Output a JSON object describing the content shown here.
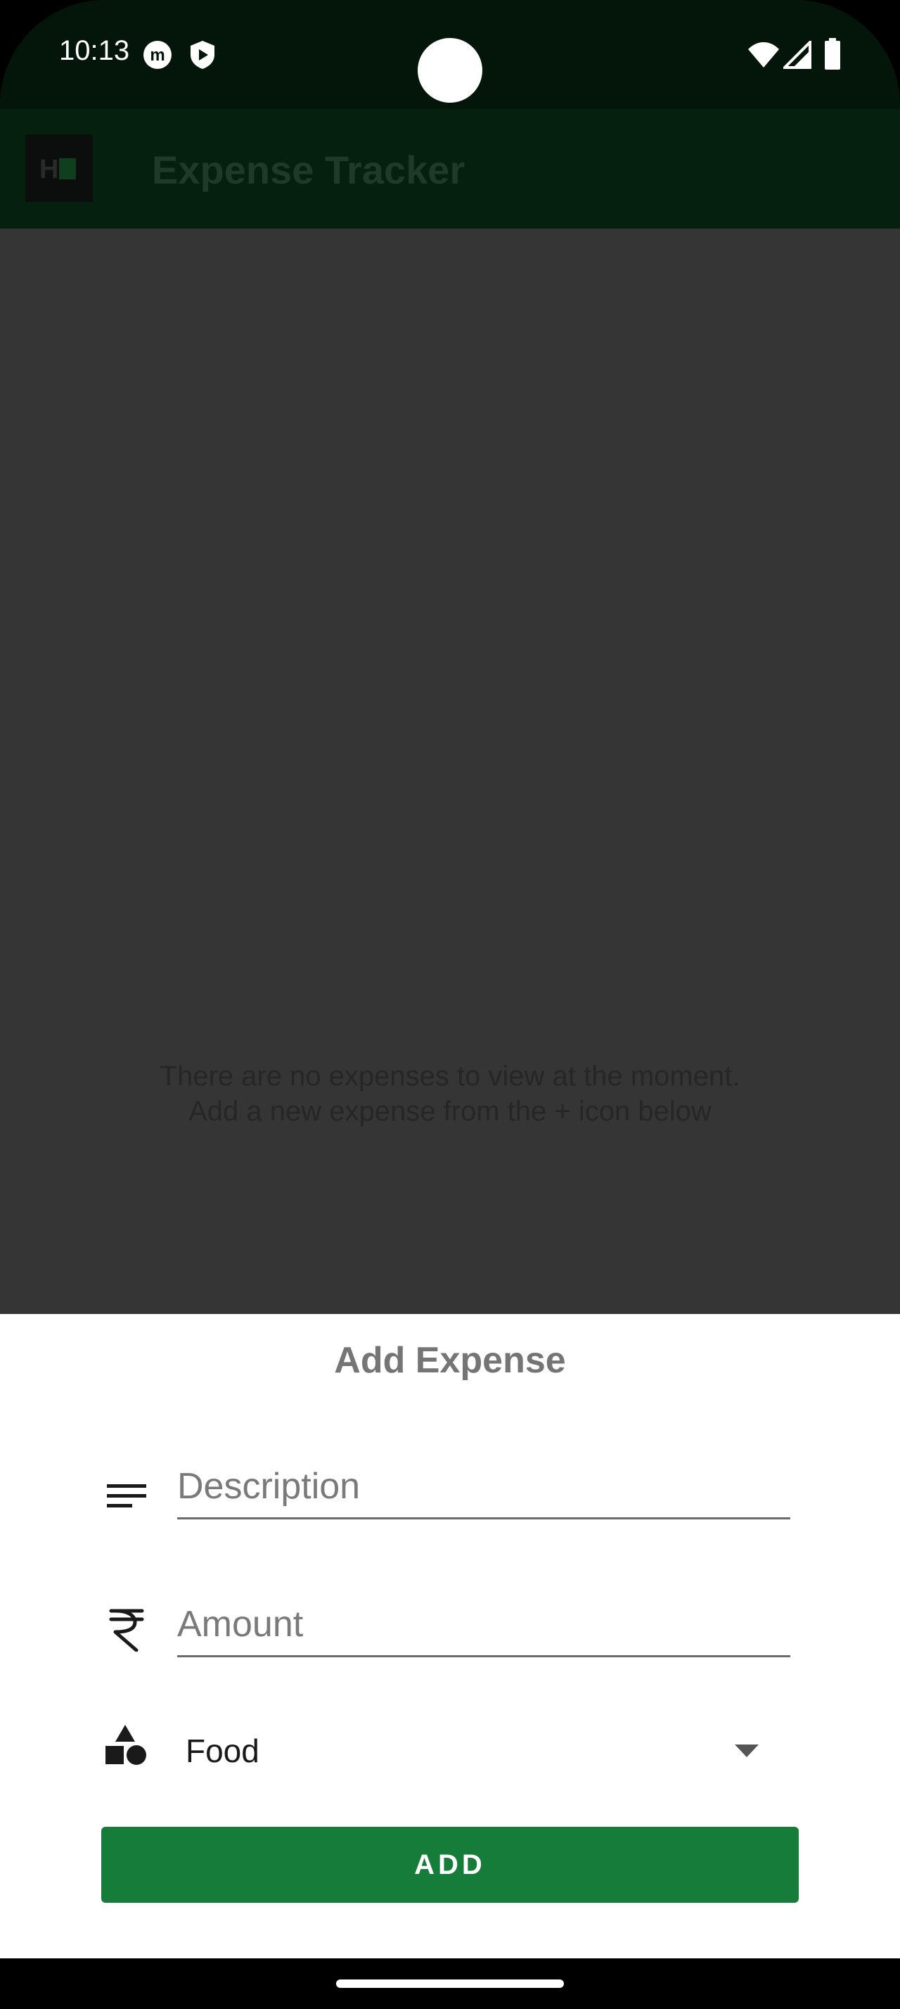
{
  "status_bar": {
    "time": "10:13",
    "icons": [
      "m-notification-icon",
      "shield-play-icon",
      "wifi-icon",
      "signal-icon",
      "battery-icon"
    ]
  },
  "app_bar": {
    "title": "Expense Tracker",
    "logo_text": "H"
  },
  "empty_state": {
    "line1": "There are no expenses to view at the moment.",
    "line2": "Add a new expense from the + icon below"
  },
  "sheet": {
    "title": "Add Expense",
    "description_field": {
      "placeholder": "Description",
      "value": ""
    },
    "amount_field": {
      "placeholder": "Amount",
      "value": ""
    },
    "category_select": {
      "selected": "Food"
    },
    "add_button_label": "ADD"
  },
  "colors": {
    "accent": "#167c3a",
    "status_bar": "#041509",
    "app_bar": "#06200f",
    "overlay_background": "#353535",
    "sheet_background": "#ffffff"
  }
}
